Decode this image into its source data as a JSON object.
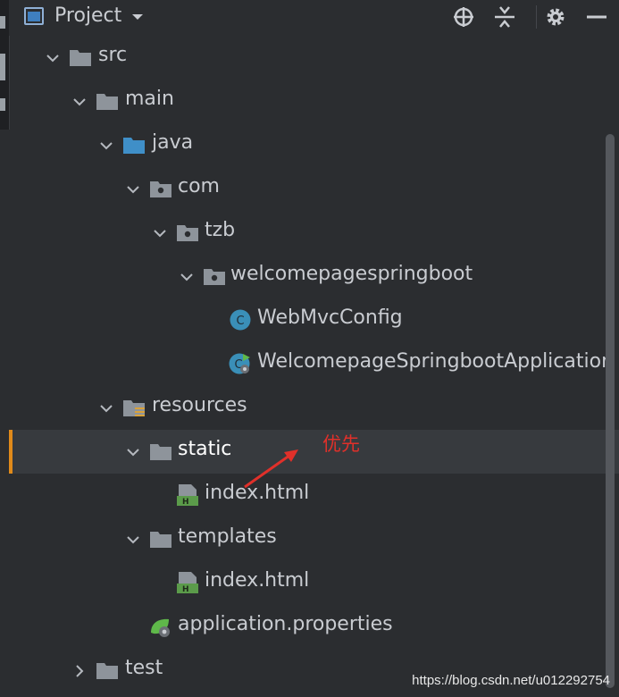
{
  "toolbar": {
    "title": "Project",
    "icons": [
      "project-view-icon",
      "dropdown-icon",
      "locate-icon",
      "collapse-all-icon",
      "settings-gear-icon",
      "minimize-icon"
    ]
  },
  "tree": [
    {
      "label": "src",
      "type": "folder",
      "expanded": true
    },
    {
      "label": "main",
      "type": "folder",
      "expanded": true
    },
    {
      "label": "java",
      "type": "source-folder",
      "expanded": true
    },
    {
      "label": "com",
      "type": "package",
      "expanded": true
    },
    {
      "label": "tzb",
      "type": "package",
      "expanded": true
    },
    {
      "label": "welcomepagespringboot",
      "type": "package",
      "expanded": true
    },
    {
      "label": "WebMvcConfig",
      "type": "class"
    },
    {
      "label": "WelcomepageSpringbootApplication",
      "type": "spring-boot-class"
    },
    {
      "label": "resources",
      "type": "resources-folder",
      "expanded": true
    },
    {
      "label": "static",
      "type": "folder",
      "expanded": true,
      "selected": true
    },
    {
      "label": "index.html",
      "type": "html-file"
    },
    {
      "label": "templates",
      "type": "folder",
      "expanded": true
    },
    {
      "label": "index.html",
      "type": "html-file"
    },
    {
      "label": "application.properties",
      "type": "spring-properties"
    },
    {
      "label": "test",
      "type": "folder",
      "expanded": false
    }
  ],
  "annotation": {
    "text": "优先",
    "color": "#e0302a"
  },
  "watermark": "https://blog.csdn.net/u012292754",
  "colors": {
    "background": "#2b2d30",
    "selection": "#373a3e",
    "marker": "#e08a1a",
    "folder": "#8e949b",
    "source_folder": "#3f8fc8",
    "class_icon": "#3a8fb8",
    "html_icon": "#5b9b4a"
  }
}
